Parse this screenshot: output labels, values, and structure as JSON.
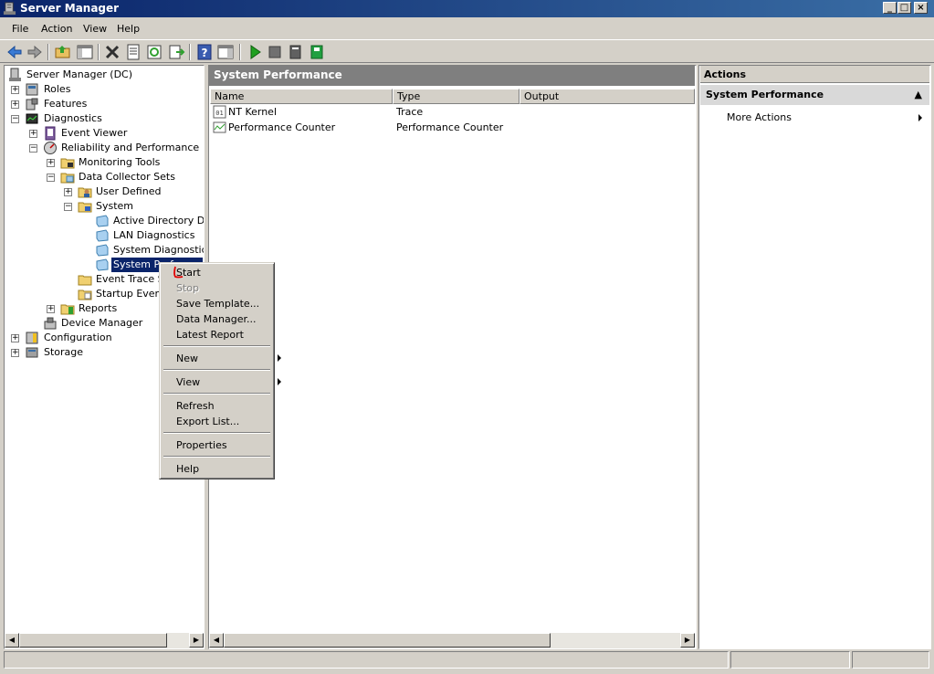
{
  "window": {
    "title": "Server Manager"
  },
  "menubar": {
    "items": [
      "File",
      "Action",
      "View",
      "Help"
    ]
  },
  "tree": {
    "items": [
      {
        "label": "Server Manager (DC)",
        "icon": "server-icon"
      },
      {
        "label": "Roles",
        "icon": "roles-icon"
      },
      {
        "label": "Features",
        "icon": "features-icon"
      },
      {
        "label": "Diagnostics",
        "icon": "diagnostics-icon"
      },
      {
        "label": "Event Viewer",
        "icon": "event-viewer-icon"
      },
      {
        "label": "Reliability and Performance",
        "icon": "performance-icon"
      },
      {
        "label": "Monitoring Tools",
        "icon": "folder-icon"
      },
      {
        "label": "Data Collector Sets",
        "icon": "folder-icon"
      },
      {
        "label": "User Defined",
        "icon": "user-folder-icon"
      },
      {
        "label": "System",
        "icon": "system-folder-icon"
      },
      {
        "label": "Active Directory Diag",
        "icon": "collector-set-icon"
      },
      {
        "label": "LAN Diagnostics",
        "icon": "collector-set-icon"
      },
      {
        "label": "System Diagnostics",
        "icon": "collector-set-icon"
      },
      {
        "label": "System Perf",
        "icon": "collector-set-icon"
      },
      {
        "label": "Event Trace Se",
        "icon": "folder-icon"
      },
      {
        "label": "Startup Event",
        "icon": "folder-icon"
      },
      {
        "label": "Reports",
        "icon": "reports-icon"
      },
      {
        "label": "Device Manager",
        "icon": "device-manager-icon"
      },
      {
        "label": "Configuration",
        "icon": "configuration-icon"
      },
      {
        "label": "Storage",
        "icon": "storage-icon"
      }
    ]
  },
  "center": {
    "title": "System Performance",
    "columns": [
      "Name",
      "Type",
      "Output"
    ],
    "rows": [
      {
        "name": "NT Kernel",
        "type": "Trace",
        "output": ""
      },
      {
        "name": "Performance Counter",
        "type": "Performance Counter",
        "output": ""
      }
    ]
  },
  "actions": {
    "title": "Actions",
    "section": "System Performance",
    "more": "More Actions"
  },
  "context_menu": {
    "start": "Start",
    "stop": "Stop",
    "save_template": "Save Template...",
    "data_manager": "Data Manager...",
    "latest_report": "Latest Report",
    "new": "New",
    "view": "View",
    "refresh": "Refresh",
    "export_list": "Export List...",
    "properties": "Properties",
    "help": "Help"
  },
  "colors": {
    "title_start": "#0a246a",
    "title_end": "#3a6ea5",
    "selection": "#0a246a",
    "annotation": "#e00000"
  }
}
